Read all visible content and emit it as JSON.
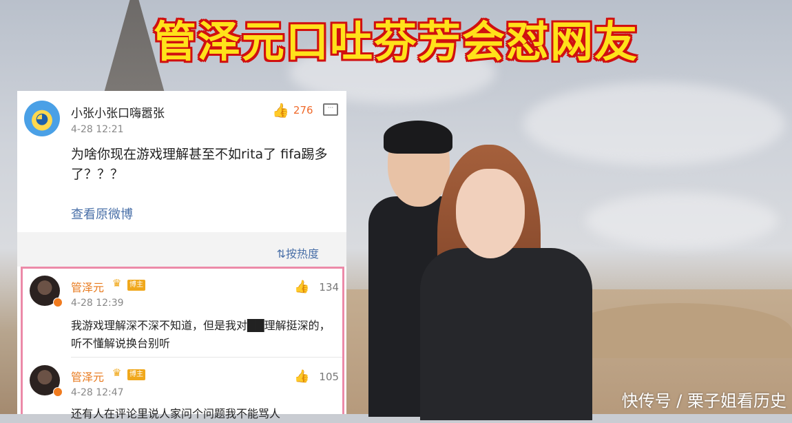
{
  "headline": "管泽元口吐芬芳会怼网友",
  "post": {
    "author": "小张小张口嗨嚣张",
    "time": "4-28 12:21",
    "likes": "276",
    "text": "为啥你现在游戏理解甚至不如rita了 fifa踢多了？？？",
    "view_original": "查看原微博"
  },
  "sort": {
    "label": "按热度",
    "icon": "sort-icon"
  },
  "replies": [
    {
      "author": "管泽元",
      "badge": "博主",
      "time": "4-28 12:39",
      "likes": "134",
      "text": "我游戏理解深不深不知道，但是我对██理解挺深的，听不懂解说换台别听"
    },
    {
      "author": "管泽元",
      "badge": "博主",
      "time": "4-28 12:47",
      "likes": "105",
      "text": "还有人在评论里说人家问个问题我不能骂人"
    }
  ],
  "watermark": "快传号 / 栗子姐看历史",
  "colors": {
    "headline_fill": "#ffe21a",
    "headline_outline": "#d01010",
    "link_blue": "#4a70a8",
    "like_orange": "#f06a2b",
    "author_orange": "#e8791c",
    "highlight_pink": "#ec8aa8"
  }
}
